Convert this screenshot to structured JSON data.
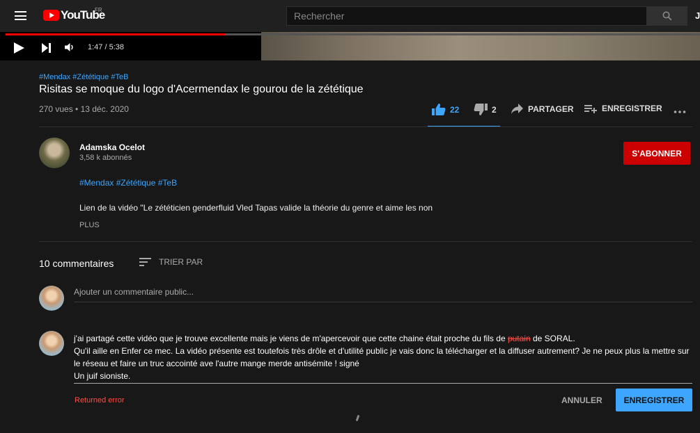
{
  "masthead": {
    "logo_text": "YouTube",
    "region": "FR",
    "search_placeholder": "Rechercher",
    "profile_initial": "J"
  },
  "player": {
    "time": "1:47 / 5:38",
    "progress_fraction": 0.316
  },
  "video": {
    "hashtags": "#Mendax #Zététique #TeB",
    "title": "Risitas se moque du logo d'Acermendax le gourou de la zététique",
    "meta": "270 vues • 13 déc. 2020",
    "likes": "22",
    "dislikes": "2",
    "share_label": "PARTAGER",
    "save_label": "ENREGISTRER"
  },
  "channel": {
    "name": "Adamska Ocelot",
    "subscribers": "3,58 k abonnés",
    "subscribe_label": "S'ABONNER"
  },
  "description": {
    "hashtags": "#Mendax #Zététique #TeB",
    "text": "Lien de la vidéo \"Le zététicien genderfluid Vled Tapas valide la théorie du genre et aime les non",
    "more_label": "PLUS"
  },
  "comments": {
    "count_label": "10 commentaires",
    "sort_label": "TRIER PAR",
    "add_placeholder": "Ajouter un commentaire public...",
    "draft_before": "j'ai partagé cette vidéo que je trouve excellente mais je viens de m'apercevoir que cette chaine était proche du fils de ",
    "draft_strike": "putain",
    "draft_after": " de SORAL.",
    "draft_line2": " Qu'il aille en Enfer ce mec.  La vidéo présente est toutefois très drôle et d'utilité public je vais donc la télécharger et la diffuser autrement? Je ne peux plus la mettre sur le réseau et faire un truc accointé ave l'autre mange merde antisémite ! signé",
    "draft_line3": "Un juif sioniste.",
    "error_text": "Returned error",
    "cancel_label": "ANNULER",
    "submit_label": "ENREGISTRER"
  },
  "colors": {
    "accent_blue": "#3ea6ff",
    "brand_red": "#ff0000",
    "subscribe_red": "#cc0000",
    "error_red": "#ff4e45",
    "background": "#181818"
  }
}
